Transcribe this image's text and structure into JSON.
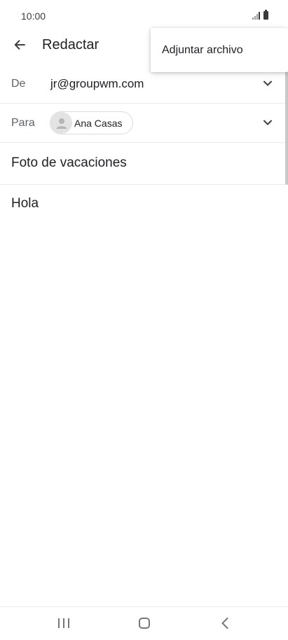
{
  "status_bar": {
    "time": "10:00"
  },
  "app_bar": {
    "title": "Redactar"
  },
  "overflow_menu": {
    "items": [
      {
        "label": "Adjuntar archivo"
      }
    ]
  },
  "compose": {
    "from_label": "De",
    "from_value": "jr@groupwm.com",
    "to_label": "Para",
    "to_recipients": [
      {
        "name": "Ana Casas"
      }
    ],
    "subject": "Foto de vacaciones",
    "body": "Hola"
  },
  "icons": {
    "back": "arrow-left-icon",
    "dropdown": "chevron-down-icon",
    "avatar": "person-icon",
    "nav_recents": "recents-icon",
    "nav_home": "home-icon",
    "nav_back": "chevron-left-icon"
  },
  "colors": {
    "text": "#202124",
    "label": "#5f6368",
    "divider": "#ececec"
  }
}
